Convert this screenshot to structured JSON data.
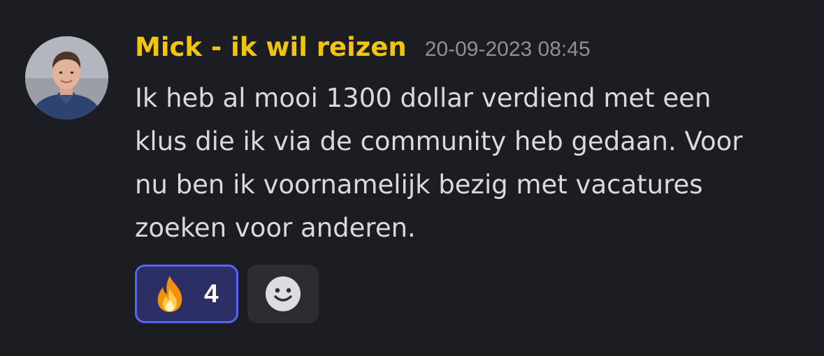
{
  "message": {
    "author": "Mick - ik wil reizen",
    "timestamp": "20-09-2023 08:45",
    "author_color": "#f1c40f",
    "content_lines": [
      "Ik heb al mooi 1300 dollar verdiend met een",
      "klus die ik via de community heb gedaan. Voor",
      "nu ben ik voornamelijk bezig met vacatures",
      "zoeken voor anderen."
    ]
  },
  "reactions": [
    {
      "emoji_icon": "fire-icon",
      "count": "4",
      "selected": true
    }
  ],
  "add_reaction": {
    "icon": "smiley-face-icon"
  }
}
